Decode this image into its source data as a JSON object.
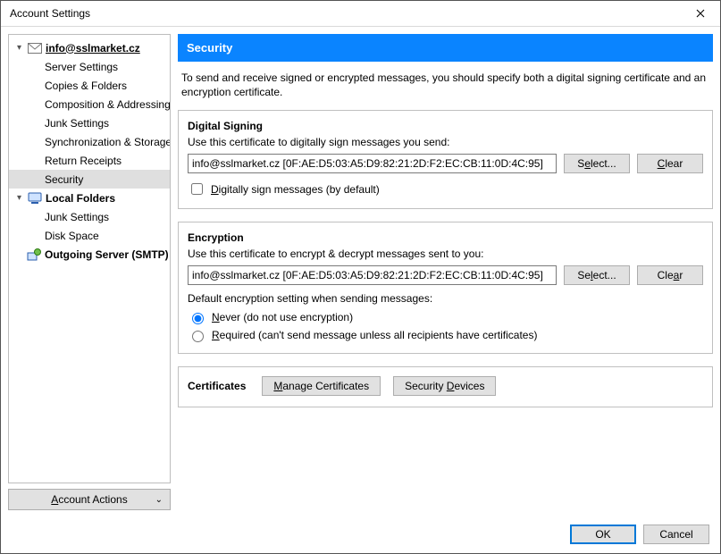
{
  "window": {
    "title": "Account Settings"
  },
  "sidebar": {
    "account_email": "info@sslmarket.cz",
    "items": [
      "Server Settings",
      "Copies & Folders",
      "Composition & Addressing",
      "Junk Settings",
      "Synchronization & Storage",
      "Return Receipts",
      "Security"
    ],
    "local_folders_label": "Local Folders",
    "local_items": [
      "Junk Settings",
      "Disk Space"
    ],
    "smtp_label": "Outgoing Server (SMTP)",
    "account_actions": "Account Actions"
  },
  "header": {
    "title": "Security"
  },
  "intro": "To send and receive signed or encrypted messages, you should specify both a digital signing certificate and an encryption certificate.",
  "signing": {
    "title": "Digital Signing",
    "desc": "Use this certificate to digitally sign messages you send:",
    "cert_value": "info@sslmarket.cz [0F:AE:D5:03:A5:D9:82:21:2D:F2:EC:CB:11:0D:4C:95]",
    "select_label": "Select...",
    "clear_label": "Clear",
    "checkbox_prefix": "D",
    "checkbox_rest": "igitally sign messages (by default)"
  },
  "encryption": {
    "title": "Encryption",
    "desc": "Use this certificate to encrypt & decrypt messages sent to you:",
    "cert_value": "info@sslmarket.cz [0F:AE:D5:03:A5:D9:82:21:2D:F2:EC:CB:11:0D:4C:95]",
    "select_label": "Select...",
    "clear_label": "Clear",
    "default_label": "Default encryption setting when sending messages:",
    "opt_never_u": "N",
    "opt_never_rest": "ever (do not use encryption)",
    "opt_required_u": "R",
    "opt_required_rest": "equired (can't send message unless all recipients have certificates)"
  },
  "certs": {
    "label": "Certificates",
    "manage_u": "M",
    "manage_rest": "anage Certificates",
    "devices_pre": "Security ",
    "devices_u": "D",
    "devices_rest": "evices"
  },
  "footer": {
    "ok": "OK",
    "cancel": "Cancel"
  }
}
